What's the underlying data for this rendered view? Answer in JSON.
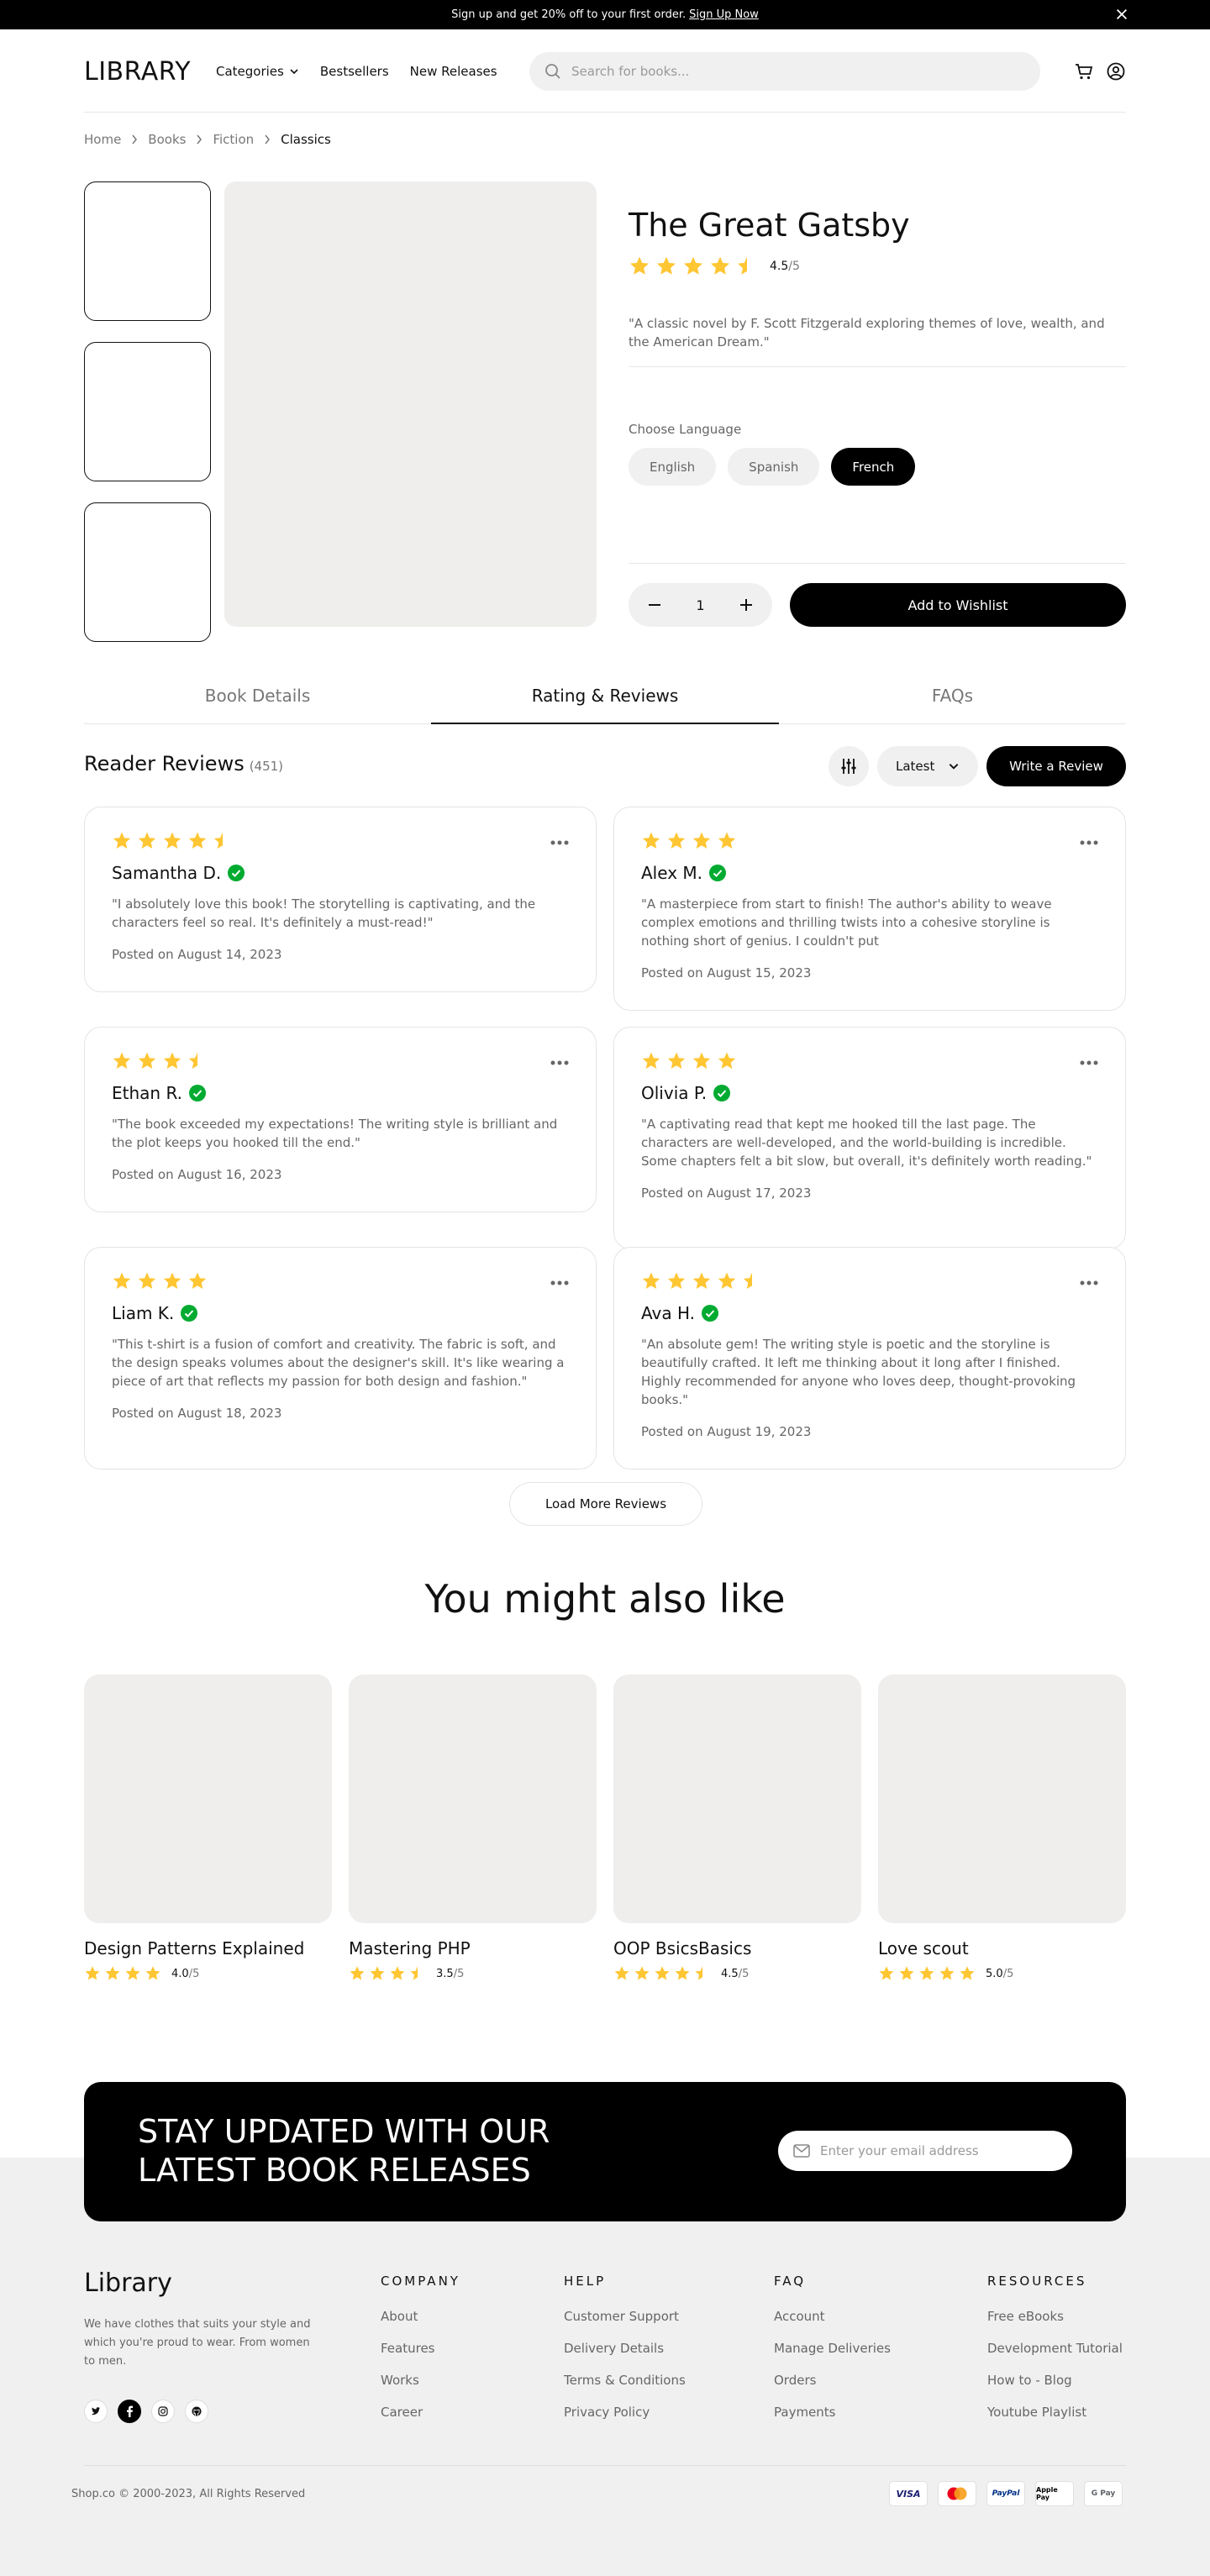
{
  "banner": {
    "text": "Sign up and get 20% off to your first order.",
    "link": "Sign Up Now"
  },
  "header": {
    "logo": "LIBRARY",
    "nav": [
      "Categories",
      "Bestsellers",
      "New Releases"
    ],
    "search_placeholder": "Search for books..."
  },
  "breadcrumb": [
    "Home",
    "Books",
    "Fiction",
    "Classics"
  ],
  "product": {
    "title": "The Great Gatsby",
    "rating": "4.5",
    "rating_max": "/5",
    "description": "\"A classic novel by F. Scott Fitzgerald exploring themes of love, wealth, and the American Dream.\"",
    "language_label": "Choose Language",
    "languages": [
      "English",
      "Spanish",
      "French"
    ],
    "selected_language": "French",
    "quantity": "1",
    "wishlist_label": "Add to Wishlist"
  },
  "tabs": [
    "Book Details",
    "Rating & Reviews",
    "FAQs"
  ],
  "reviews": {
    "title": "Reader Reviews",
    "count": "(451)",
    "sort": "Latest",
    "write_label": "Write a Review",
    "load_more": "Load More Reviews",
    "items": [
      {
        "rating": 4.5,
        "name": "Samantha D.",
        "text": "\"I absolutely love this book! The storytelling is captivating, and the characters feel so real. It's definitely a must-read!\"",
        "date": "Posted on August 14, 2023"
      },
      {
        "rating": 4,
        "name": "Alex M.",
        "text": "\"A masterpiece from start to finish! The author's ability to weave complex emotions and thrilling twists into a cohesive storyline is nothing short of genius. I couldn't put",
        "date": "Posted on August 15, 2023"
      },
      {
        "rating": 3.5,
        "name": "Ethan R.",
        "text": "\"The book exceeded my expectations! The writing style is brilliant and the plot keeps you hooked till the end.\"",
        "date": "Posted on August 16, 2023"
      },
      {
        "rating": 4,
        "name": "Olivia P.",
        "text": "\"A captivating read that kept me hooked till the last page. The characters are well-developed, and the world-building is incredible. Some chapters felt a bit slow, but overall, it's definitely worth reading.\"",
        "date": "Posted on August 17, 2023"
      },
      {
        "rating": 4,
        "name": "Liam K.",
        "text": "\"This t-shirt is a fusion of comfort and creativity. The fabric is soft, and the design speaks volumes about the designer's skill. It's like wearing a piece of art that reflects my passion for both design and fashion.\"",
        "date": "Posted on August 18, 2023"
      },
      {
        "rating": 4.5,
        "name": "Ava H.",
        "text": "\"An absolute gem! The writing style is poetic and the storyline is beautifully crafted. It left me thinking about it long after I finished. Highly recommended for anyone who loves deep, thought-provoking books.\"",
        "date": "Posted on August 19, 2023"
      }
    ]
  },
  "also_like": {
    "title": "You might also like",
    "items": [
      {
        "name": "Design Patterns Explained",
        "rating": 4.0,
        "rating_text": "4.0",
        "rating_max": "/5"
      },
      {
        "name": "Mastering PHP",
        "rating": 3.5,
        "rating_text": "3.5",
        "rating_max": "/5"
      },
      {
        "name": "OOP BsicsBasics",
        "rating": 4.5,
        "rating_text": "4.5",
        "rating_max": "/5"
      },
      {
        "name": "Love scout",
        "rating": 5.0,
        "rating_text": "5.0",
        "rating_max": "/5"
      }
    ]
  },
  "newsletter": {
    "title": "STAY UPDATED WITH OUR LATEST BOOK RELEASES",
    "placeholder": "Enter your email address"
  },
  "footer": {
    "logo": "Library",
    "description": "We have clothes that suits your style and which you're proud to wear. From women to men.",
    "columns": [
      {
        "title": "COMPANY",
        "links": [
          "About",
          "Features",
          "Works",
          "Career"
        ]
      },
      {
        "title": "HELP",
        "links": [
          "Customer Support",
          "Delivery Details",
          "Terms & Conditions",
          "Privacy Policy"
        ]
      },
      {
        "title": "FAQ",
        "links": [
          "Account",
          "Manage Deliveries",
          "Orders",
          "Payments"
        ]
      },
      {
        "title": "RESOURCES",
        "links": [
          "Free eBooks",
          "Development Tutorial",
          "How to - Blog",
          "Youtube Playlist"
        ]
      }
    ],
    "copyright": "Shop.co © 2000-2023, All Rights Reserved",
    "payments": [
      "VISA",
      "mastercard",
      "PayPal",
      "Apple Pay",
      "G Pay"
    ]
  },
  "colors": {
    "star": "#FFC633",
    "verified": "#01AB31",
    "accent": "#000000"
  }
}
